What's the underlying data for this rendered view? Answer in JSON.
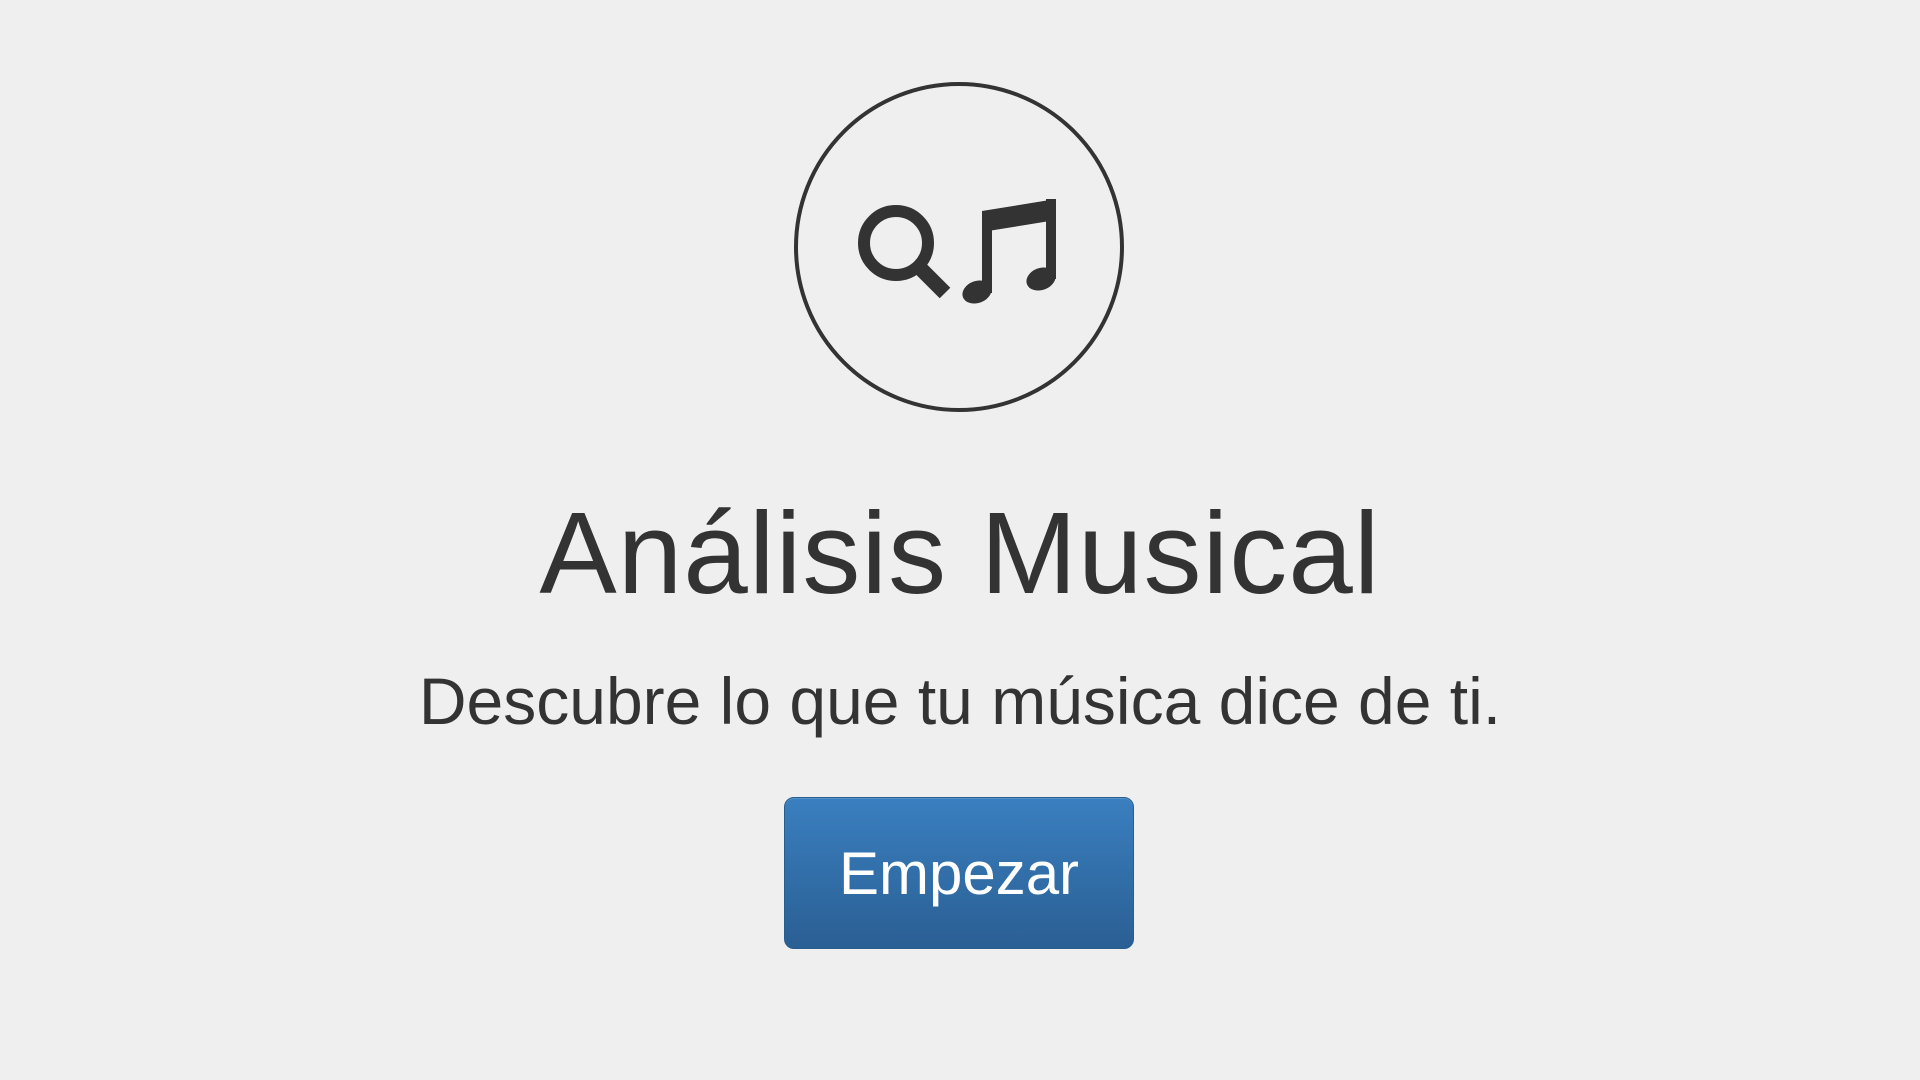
{
  "logo": {
    "icons": [
      "search-icon",
      "music-note-icon"
    ],
    "stroke_color": "#333333"
  },
  "hero": {
    "title": "Análisis Musical",
    "subtitle": "Descubre lo que tu música dice de ti."
  },
  "actions": {
    "start_label": "Empezar"
  },
  "colors": {
    "background": "#efefef",
    "text": "#333333",
    "button_top": "#3a7fc0",
    "button_bottom": "#2a5f93",
    "button_text": "#ffffff"
  }
}
